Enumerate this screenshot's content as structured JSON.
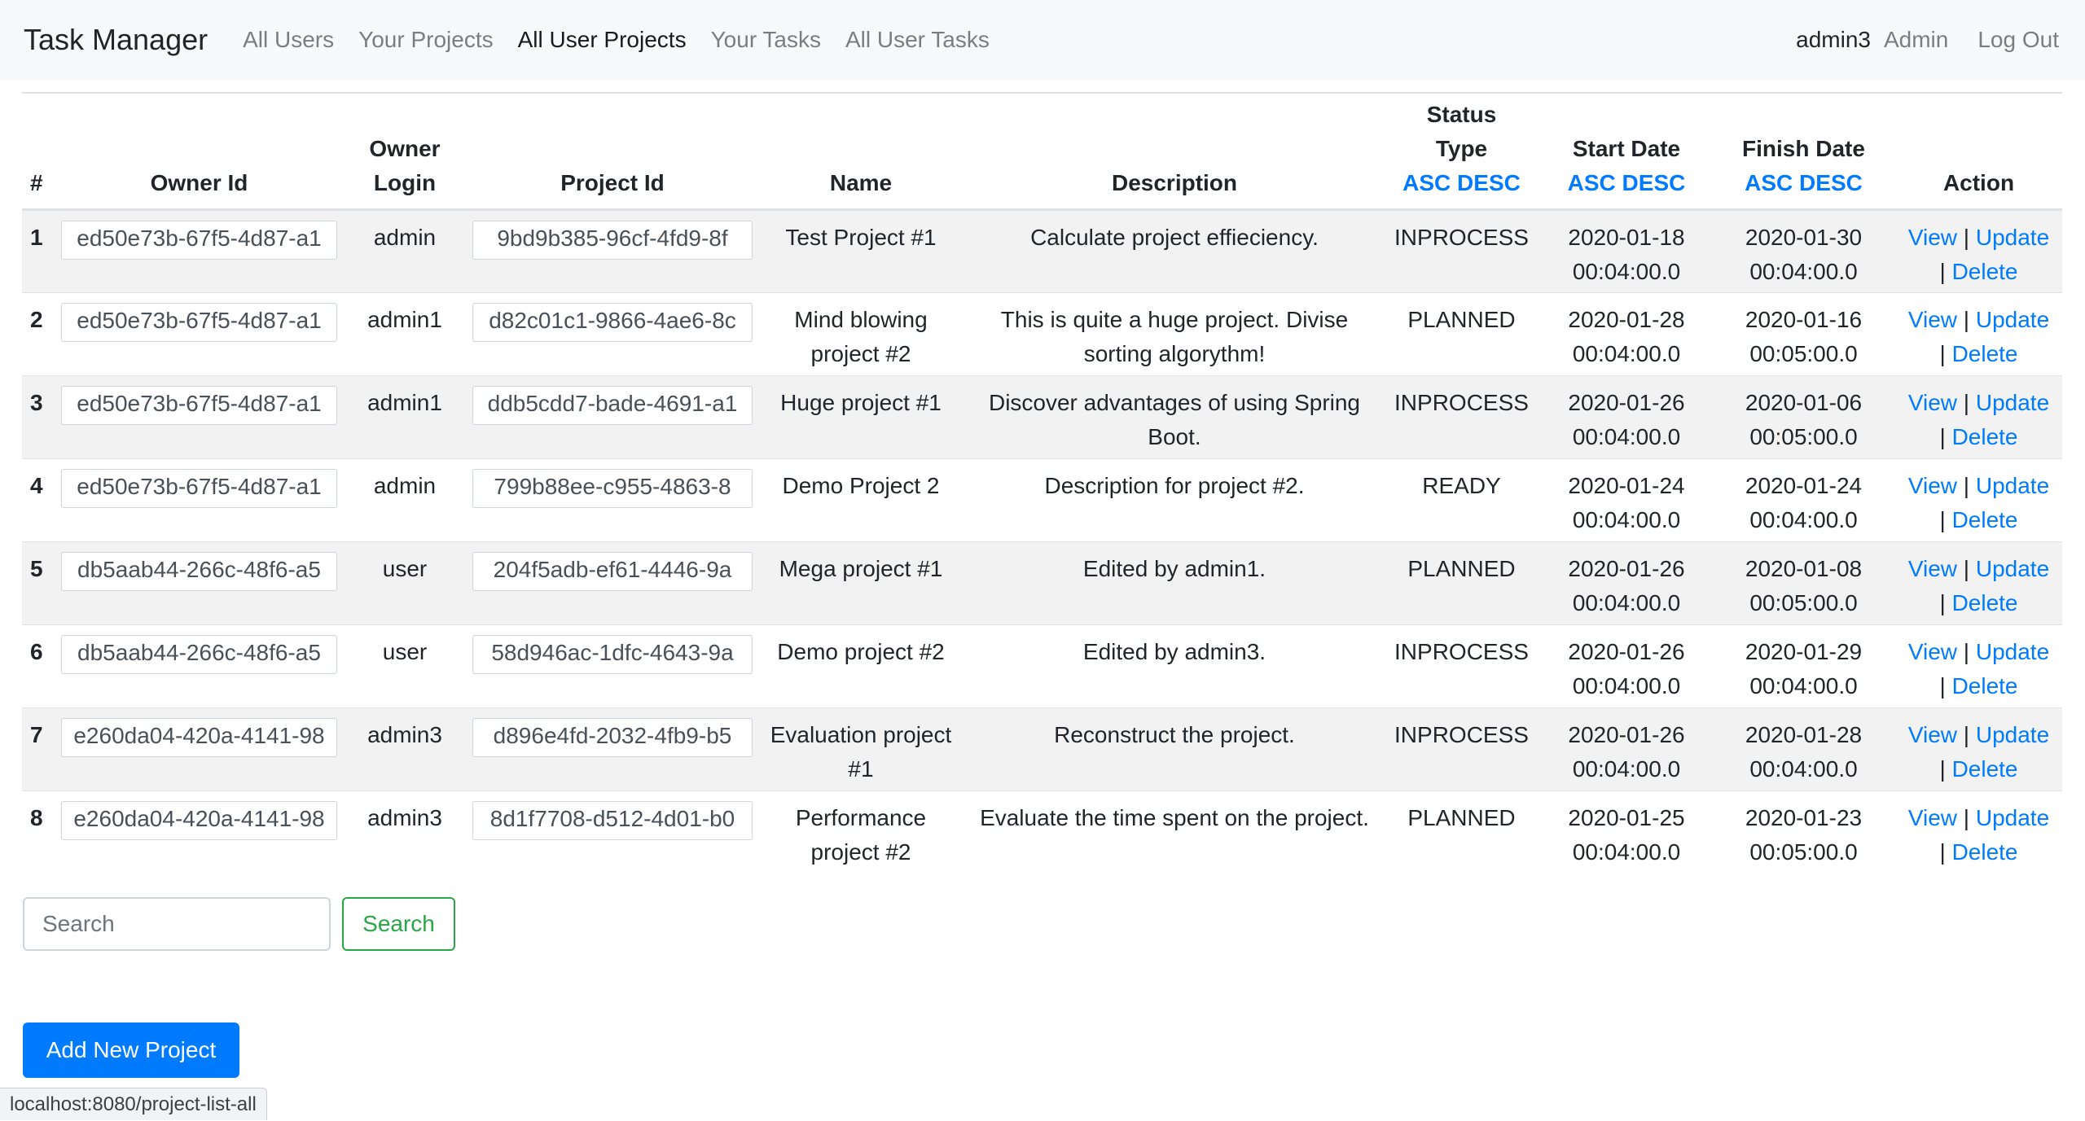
{
  "navbar": {
    "brand": "Task Manager",
    "links": [
      "All Users",
      "Your Projects",
      "All User Projects",
      "Your Tasks",
      "All User Tasks"
    ],
    "active_index": 2,
    "user_name": "admin3",
    "admin_link": "Admin",
    "logout": "Log Out"
  },
  "table": {
    "headers": {
      "num": "#",
      "owner_id": "Owner Id",
      "owner_login_1": "Owner",
      "owner_login_2": "Login",
      "project_id": "Project Id",
      "name": "Name",
      "description": "Description",
      "status_1": "Status",
      "status_2": "Type",
      "start_date": "Start Date",
      "finish_date": "Finish Date",
      "action": "Action",
      "asc": "ASC",
      "desc": "DESC"
    },
    "action_labels": {
      "view": "View",
      "update": "Update",
      "delete": "Delete",
      "sep": "|"
    },
    "rows": [
      {
        "num": "1",
        "owner_id": "ed50e73b-67f5-4d87-a1",
        "owner_login": "admin",
        "project_id": "9bd9b385-96cf-4fd9-8f",
        "name": "Test Project #1",
        "description": "Calculate project effieciency.",
        "status": "INPROCESS",
        "start_date": "2020-01-18",
        "start_time": "00:04:00.0",
        "finish_date": "2020-01-30",
        "finish_time": "00:04:00.0"
      },
      {
        "num": "2",
        "owner_id": "ed50e73b-67f5-4d87-a1",
        "owner_login": "admin1",
        "project_id": "d82c01c1-9866-4ae6-8c",
        "name": "Mind blowing project #2",
        "description": "This is quite a huge project. Divise sorting algorythm!",
        "status": "PLANNED",
        "start_date": "2020-01-28",
        "start_time": "00:04:00.0",
        "finish_date": "2020-01-16",
        "finish_time": "00:05:00.0"
      },
      {
        "num": "3",
        "owner_id": "ed50e73b-67f5-4d87-a1",
        "owner_login": "admin1",
        "project_id": "ddb5cdd7-bade-4691-a1",
        "name": "Huge project #1",
        "description": "Discover advantages of using Spring Boot.",
        "status": "INPROCESS",
        "start_date": "2020-01-26",
        "start_time": "00:04:00.0",
        "finish_date": "2020-01-06",
        "finish_time": "00:05:00.0"
      },
      {
        "num": "4",
        "owner_id": "ed50e73b-67f5-4d87-a1",
        "owner_login": "admin",
        "project_id": "799b88ee-c955-4863-8",
        "name": "Demo Project 2",
        "description": "Description for project #2.",
        "status": "READY",
        "start_date": "2020-01-24",
        "start_time": "00:04:00.0",
        "finish_date": "2020-01-24",
        "finish_time": "00:04:00.0"
      },
      {
        "num": "5",
        "owner_id": "db5aab44-266c-48f6-a5",
        "owner_login": "user",
        "project_id": "204f5adb-ef61-4446-9a",
        "name": "Mega project #1",
        "description": "Edited by admin1.",
        "status": "PLANNED",
        "start_date": "2020-01-26",
        "start_time": "00:04:00.0",
        "finish_date": "2020-01-08",
        "finish_time": "00:05:00.0"
      },
      {
        "num": "6",
        "owner_id": "db5aab44-266c-48f6-a5",
        "owner_login": "user",
        "project_id": "58d946ac-1dfc-4643-9a",
        "name": "Demo project #2",
        "description": "Edited by admin3.",
        "status": "INPROCESS",
        "start_date": "2020-01-26",
        "start_time": "00:04:00.0",
        "finish_date": "2020-01-29",
        "finish_time": "00:04:00.0"
      },
      {
        "num": "7",
        "owner_id": "e260da04-420a-4141-98",
        "owner_login": "admin3",
        "project_id": "d896e4fd-2032-4fb9-b5",
        "name": "Evaluation project #1",
        "description": "Reconstruct the project.",
        "status": "INPROCESS",
        "start_date": "2020-01-26",
        "start_time": "00:04:00.0",
        "finish_date": "2020-01-28",
        "finish_time": "00:04:00.0"
      },
      {
        "num": "8",
        "owner_id": "e260da04-420a-4141-98",
        "owner_login": "admin3",
        "project_id": "8d1f7708-d512-4d01-b0",
        "name": "Performance project #2",
        "description": "Evaluate the time spent on the project.",
        "status": "PLANNED",
        "start_date": "2020-01-25",
        "start_time": "00:04:00.0",
        "finish_date": "2020-01-23",
        "finish_time": "00:05:00.0"
      }
    ]
  },
  "search": {
    "placeholder": "Search",
    "button": "Search"
  },
  "add_button": "Add New Project",
  "status_bar": "localhost:8080/project-list-all",
  "colors": {
    "link": "#007bff",
    "success": "#28a745",
    "primary": "#007bff",
    "navbar_bg": "#f8f9fa"
  }
}
